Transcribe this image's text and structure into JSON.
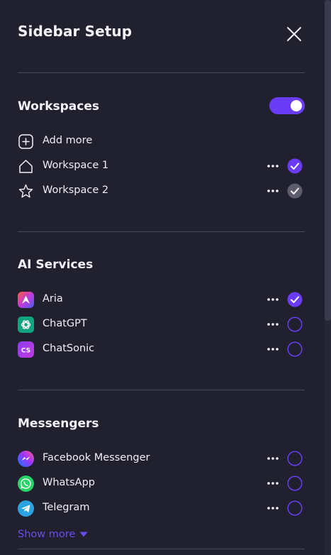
{
  "header": {
    "title": "Sidebar Setup"
  },
  "sections": {
    "workspaces": {
      "title": "Workspaces",
      "toggle_on": true,
      "add_more_label": "Add more",
      "items": [
        {
          "label": "Workspace 1",
          "icon": "home-icon",
          "checked": true,
          "check_style": "accent"
        },
        {
          "label": "Workspace 2",
          "icon": "star-icon",
          "checked": true,
          "check_style": "muted"
        }
      ]
    },
    "ai_services": {
      "title": "AI Services",
      "items": [
        {
          "label": "Aria",
          "icon": "aria-icon",
          "checked": true
        },
        {
          "label": "ChatGPT",
          "icon": "chatgpt-icon",
          "checked": false
        },
        {
          "label": "ChatSonic",
          "icon": "chatsonic-icon",
          "badge_text": "CS",
          "checked": false
        }
      ]
    },
    "messengers": {
      "title": "Messengers",
      "items": [
        {
          "label": "Facebook Messenger",
          "icon": "facebook-messenger-icon",
          "checked": false
        },
        {
          "label": "WhatsApp",
          "icon": "whatsapp-icon",
          "checked": false
        },
        {
          "label": "Telegram",
          "icon": "telegram-icon",
          "checked": false
        }
      ],
      "show_more_label": "Show more"
    }
  },
  "colors": {
    "background": "#20202e",
    "accent": "#6b3cf5",
    "link": "#6b4cf0",
    "divider": "#484862",
    "checkbox_muted": "#5d5d6e"
  }
}
